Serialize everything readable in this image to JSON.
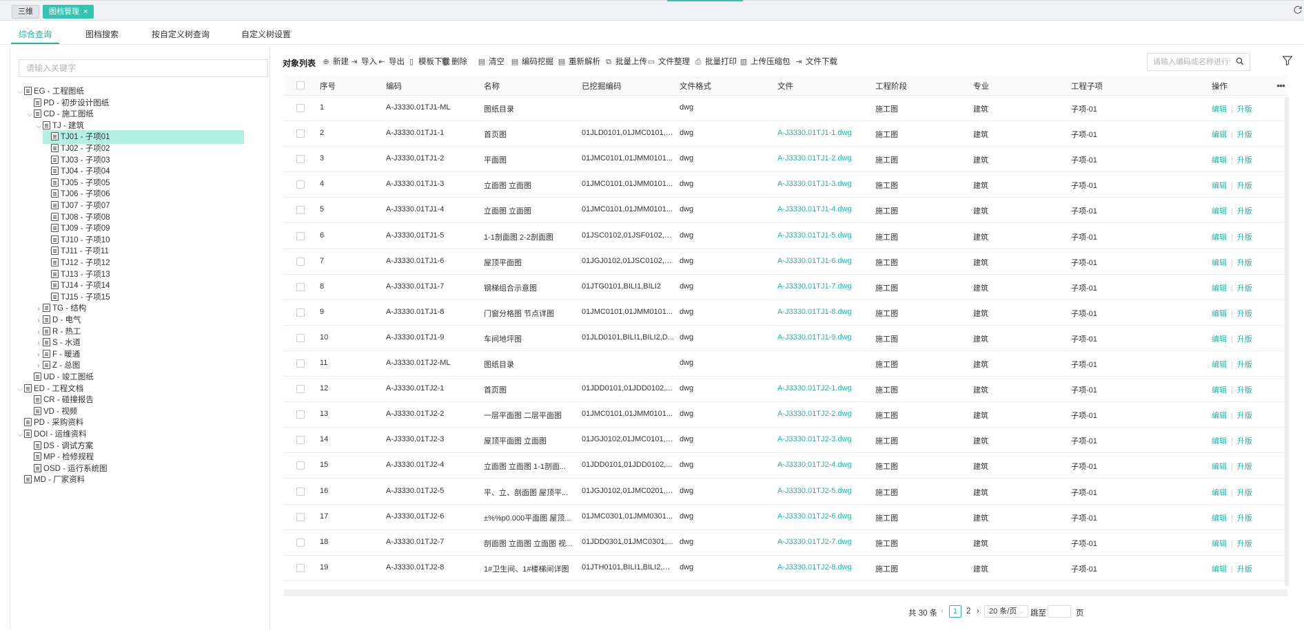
{
  "top_tabs": [
    {
      "label": "三维"
    },
    {
      "label": "图档管理",
      "close": "×"
    }
  ],
  "sub_tabs": [
    "综合查询",
    "图档搜索",
    "按自定义树查询",
    "自定义树设置"
  ],
  "tree": {
    "placeholder": "请输入关键字",
    "nodes": [
      {
        "label": "EG - 工程图纸",
        "level": 0,
        "caret": "open"
      },
      {
        "label": "PD - 初步设计图纸",
        "level": 1,
        "caret": "none"
      },
      {
        "label": "CD - 施工图纸",
        "level": 1,
        "caret": "open"
      },
      {
        "label": "TJ - 建筑",
        "level": 2,
        "caret": "open"
      },
      {
        "label": "TJ01 - 子项01",
        "level": 3,
        "caret": "none",
        "selected": true
      },
      {
        "label": "TJ02 - 子项02",
        "level": 3,
        "caret": "none"
      },
      {
        "label": "TJ03 - 子项03",
        "level": 3,
        "caret": "none"
      },
      {
        "label": "TJ04 - 子项04",
        "level": 3,
        "caret": "none"
      },
      {
        "label": "TJ05 - 子项05",
        "level": 3,
        "caret": "none"
      },
      {
        "label": "TJ06 - 子项06",
        "level": 3,
        "caret": "none"
      },
      {
        "label": "TJ07 - 子项07",
        "level": 3,
        "caret": "none"
      },
      {
        "label": "TJ08 - 子项08",
        "level": 3,
        "caret": "none"
      },
      {
        "label": "TJ09 - 子项09",
        "level": 3,
        "caret": "none"
      },
      {
        "label": "TJ10 - 子项10",
        "level": 3,
        "caret": "none"
      },
      {
        "label": "TJ11 - 子项11",
        "level": 3,
        "caret": "none"
      },
      {
        "label": "TJ12 - 子项12",
        "level": 3,
        "caret": "none"
      },
      {
        "label": "TJ13 - 子项13",
        "level": 3,
        "caret": "none"
      },
      {
        "label": "TJ14 - 子项14",
        "level": 3,
        "caret": "none"
      },
      {
        "label": "TJ15 - 子项15",
        "level": 3,
        "caret": "none"
      },
      {
        "label": "TG - 结构",
        "level": 2,
        "caret": "closed"
      },
      {
        "label": "D - 电气",
        "level": 2,
        "caret": "closed"
      },
      {
        "label": "R - 热工",
        "level": 2,
        "caret": "closed"
      },
      {
        "label": "S - 水道",
        "level": 2,
        "caret": "closed"
      },
      {
        "label": "F - 暖通",
        "level": 2,
        "caret": "closed"
      },
      {
        "label": "Z - 总图",
        "level": 2,
        "caret": "closed"
      },
      {
        "label": "UD - 竣工图纸",
        "level": 1,
        "caret": "none"
      },
      {
        "label": "ED - 工程文档",
        "level": 0,
        "caret": "open"
      },
      {
        "label": "CR - 碰撞报告",
        "level": 1,
        "caret": "none"
      },
      {
        "label": "VD - 视频",
        "level": 1,
        "caret": "none"
      },
      {
        "label": "PD - 采购资料",
        "level": 0,
        "caret": "none"
      },
      {
        "label": "DOI - 运维资料",
        "level": 0,
        "caret": "open"
      },
      {
        "label": "DS - 调试方案",
        "level": 1,
        "caret": "none"
      },
      {
        "label": "MP - 检修规程",
        "level": 1,
        "caret": "none"
      },
      {
        "label": "OSD - 运行系统图",
        "level": 1,
        "caret": "none"
      },
      {
        "label": "MD - 厂家资料",
        "level": 0,
        "caret": "none"
      }
    ]
  },
  "toolbar": {
    "title": "对象列表",
    "buttons": [
      {
        "label": "新建",
        "icon": "plus-circle-icon",
        "glyph": "⊕"
      },
      {
        "label": "导入",
        "icon": "import-icon",
        "glyph": "⇥"
      },
      {
        "label": "导出",
        "icon": "export-icon",
        "glyph": "⇤"
      },
      {
        "label": "模板下载",
        "icon": "template-download-icon",
        "glyph": "▯"
      },
      {
        "label": "删除",
        "icon": "trash-icon",
        "glyph": "🗑"
      },
      {
        "label": "清空",
        "icon": "clear-icon",
        "glyph": "▤"
      },
      {
        "label": "编码挖掘",
        "icon": "code-mining-icon",
        "glyph": "▤"
      },
      {
        "label": "重新解析",
        "icon": "reparse-icon",
        "glyph": "▤"
      },
      {
        "label": "批量上传",
        "icon": "batch-upload-icon",
        "glyph": "⧉"
      },
      {
        "label": "文件整理",
        "icon": "folder-icon",
        "glyph": "▭"
      },
      {
        "label": "批量打印",
        "icon": "printer-icon",
        "glyph": "⎙"
      },
      {
        "label": "上传压缩包",
        "icon": "archive-upload-icon",
        "glyph": "▥"
      },
      {
        "label": "文件下载",
        "icon": "file-download-icon",
        "glyph": "⇥"
      }
    ],
    "search_placeholder": "请输入编码或名称进行查询"
  },
  "table": {
    "columns": [
      "序号",
      "编码",
      "名称",
      "已挖掘编码",
      "文件格式",
      "文件",
      "工程阶段",
      "专业",
      "工程子项",
      "操作"
    ],
    "action_edit": "编辑",
    "action_upgrade": "升版",
    "rows": [
      {
        "no": "1",
        "code": "A-J3330.01TJ1-ML",
        "name": "图纸目录",
        "mined": "",
        "format": "dwg",
        "file": "",
        "stage": "施工图",
        "discipline": "建筑",
        "sub": "子项-01"
      },
      {
        "no": "2",
        "code": "A-J3330.01TJ1-1",
        "name": "首页图",
        "mined": "01JLD0101,01JMC0101,0...",
        "format": "dwg",
        "file": "A-J3330.01TJ1-1.dwg",
        "stage": "施工图",
        "discipline": "建筑",
        "sub": "子项-01"
      },
      {
        "no": "3",
        "code": "A-J3330.01TJ1-2",
        "name": "平面图",
        "mined": "01JMC0101,01JMM0101...",
        "format": "dwg",
        "file": "A-J3330.01TJ1-2.dwg",
        "stage": "施工图",
        "discipline": "建筑",
        "sub": "子项-01"
      },
      {
        "no": "4",
        "code": "A-J3330.01TJ1-3",
        "name": "立面图 立面图",
        "mined": "01JMC0101,01JMM0101...",
        "format": "dwg",
        "file": "A-J3330.01TJ1-3.dwg",
        "stage": "施工图",
        "discipline": "建筑",
        "sub": "子项-01"
      },
      {
        "no": "5",
        "code": "A-J3330.01TJ1-4",
        "name": "立面图 立面图",
        "mined": "01JMC0101,01JMM0101...",
        "format": "dwg",
        "file": "A-J3330.01TJ1-4.dwg",
        "stage": "施工图",
        "discipline": "建筑",
        "sub": "子项-01"
      },
      {
        "no": "6",
        "code": "A-J3330.01TJ1-5",
        "name": "1-1剖面图 2-2剖面图",
        "mined": "01JSC0102,01JSF0102,01...",
        "format": "dwg",
        "file": "A-J3330.01TJ1-5.dwg",
        "stage": "施工图",
        "discipline": "建筑",
        "sub": "子项-01"
      },
      {
        "no": "7",
        "code": "A-J3330.01TJ1-6",
        "name": "屋顶平面图",
        "mined": "01JGJ0102,01JSC0102,0...",
        "format": "dwg",
        "file": "A-J3330.01TJ1-6.dwg",
        "stage": "施工图",
        "discipline": "建筑",
        "sub": "子项-01"
      },
      {
        "no": "8",
        "code": "A-J3330.01TJ1-7",
        "name": "钢梯组合示意图",
        "mined": "01JTG0101,BILI1,BILI2",
        "format": "dwg",
        "file": "A-J3330.01TJ1-7.dwg",
        "stage": "施工图",
        "discipline": "建筑",
        "sub": "子项-01"
      },
      {
        "no": "9",
        "code": "A-J3330.01TJ1-8",
        "name": "门窗分格图 节点详图",
        "mined": "01JMC0101,01JMM0101...",
        "format": "dwg",
        "file": "A-J3330.01TJ1-8.dwg",
        "stage": "施工图",
        "discipline": "建筑",
        "sub": "子项-01"
      },
      {
        "no": "10",
        "code": "A-J3330.01TJ1-9",
        "name": "车间地坪图",
        "mined": "01JLD0101,BILI1,BILI2,D...",
        "format": "dwg",
        "file": "A-J3330.01TJ1-9.dwg",
        "stage": "施工图",
        "discipline": "建筑",
        "sub": "子项-01"
      },
      {
        "no": "11",
        "code": "A-J3330.01TJ2-ML",
        "name": "图纸目录",
        "mined": "",
        "format": "dwg",
        "file": "",
        "stage": "施工图",
        "discipline": "建筑",
        "sub": "子项-01"
      },
      {
        "no": "12",
        "code": "A-J3330.01TJ2-1",
        "name": "首页图",
        "mined": "01JDD0101,01JDD0102,...",
        "format": "dwg",
        "file": "A-J3330.01TJ2-1.dwg",
        "stage": "施工图",
        "discipline": "建筑",
        "sub": "子项-01"
      },
      {
        "no": "13",
        "code": "A-J3330.01TJ2-2",
        "name": "一层平面图 二层平面图",
        "mined": "01JMC0101,01JMM0101...",
        "format": "dwg",
        "file": "A-J3330.01TJ2-2.dwg",
        "stage": "施工图",
        "discipline": "建筑",
        "sub": "子项-01"
      },
      {
        "no": "14",
        "code": "A-J3330.01TJ2-3",
        "name": "屋顶平面图 立面图",
        "mined": "01JGJ0102,01JMC0101,0...",
        "format": "dwg",
        "file": "A-J3330.01TJ2-3.dwg",
        "stage": "施工图",
        "discipline": "建筑",
        "sub": "子项-01"
      },
      {
        "no": "15",
        "code": "A-J3330.01TJ2-4",
        "name": "立面图 立面图 1-1剖面...",
        "mined": "01JDD0101,01JDD0102,...",
        "format": "dwg",
        "file": "A-J3330.01TJ2-4.dwg",
        "stage": "施工图",
        "discipline": "建筑",
        "sub": "子项-01"
      },
      {
        "no": "16",
        "code": "A-J3330.01TJ2-5",
        "name": "平、立、剖面图 屋顶平...",
        "mined": "01JGJ0102,01JMC0201,0...",
        "format": "dwg",
        "file": "A-J3330.01TJ2-5.dwg",
        "stage": "施工图",
        "discipline": "建筑",
        "sub": "子项-01"
      },
      {
        "no": "17",
        "code": "A-J3330.01TJ2-6",
        "name": "±%%p0.000平面图 屋顶...",
        "mined": "01JMC0301,01JMM0301...",
        "format": "dwg",
        "file": "A-J3330.01TJ2-6.dwg",
        "stage": "施工图",
        "discipline": "建筑",
        "sub": "子项-01"
      },
      {
        "no": "18",
        "code": "A-J3330.01TJ2-7",
        "name": "剖面图 立面图 立面图 视...",
        "mined": "01JDD0301,01JMC0301,...",
        "format": "dwg",
        "file": "A-J3330.01TJ2-7.dwg",
        "stage": "施工图",
        "discipline": "建筑",
        "sub": "子项-01"
      },
      {
        "no": "19",
        "code": "A-J3330.01TJ2-8",
        "name": "1#卫生间、1#楼梯间详图",
        "mined": "01JTH0101,BILI1,BILI2,XT...",
        "format": "dwg",
        "file": "A-J3330.01TJ2-8.dwg",
        "stage": "施工图",
        "discipline": "建筑",
        "sub": "子项-01"
      }
    ]
  },
  "pager": {
    "total": "共 30 条",
    "prev": "‹",
    "pages": [
      "1",
      "2"
    ],
    "next": "›",
    "page_size": "20 条/页",
    "jump_label": "跳至",
    "page_unit": "页"
  },
  "colors": {
    "accent": "#27b3a2",
    "link": "#1fb7a6",
    "selected_bg": "#b4efe6",
    "chip": "#32c5b2"
  }
}
